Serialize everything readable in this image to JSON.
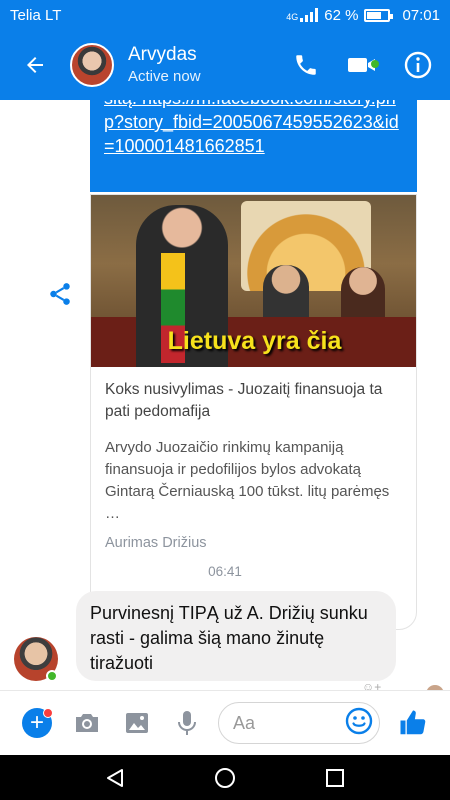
{
  "status_bar": {
    "carrier": "Telia LT",
    "network": "4G",
    "battery_percent": "62 %",
    "time": "07:01"
  },
  "header": {
    "contact_name": "Arvydas",
    "status": "Active now"
  },
  "link_message": {
    "text": "sitą. https://m.facebook.com/story.php?story_fbid=2005067459552623&id=100001481662851"
  },
  "card": {
    "image_caption": "Lietuva yra čia",
    "title": "Koks nusivylimas - Juozaitį finansuoja ta pati pedomafija",
    "description": "Arvydo Juozaičio rinkimų kampaniją finansuoja ir pedofilijos bylos advokatą Gintarą Černiauską 100 tūkst. litų parėmęs …",
    "source": "Aurimas Drižius"
  },
  "timestamp": "06:41",
  "message": {
    "text": "Purvinesnį TIPĄ už A. Drižių sunku rasti - galima šią mano žinutę tiražuoti"
  },
  "composer": {
    "placeholder": "Aa"
  },
  "colors": {
    "accent": "#0a7fe9",
    "online": "#42b72a",
    "bubble_gray": "#f1f0f0"
  },
  "icons": [
    "back-arrow",
    "phone",
    "video-camera",
    "info",
    "share",
    "plus",
    "camera",
    "image",
    "microphone",
    "emoji",
    "thumbs-up",
    "nav-back",
    "nav-home",
    "nav-recents"
  ]
}
